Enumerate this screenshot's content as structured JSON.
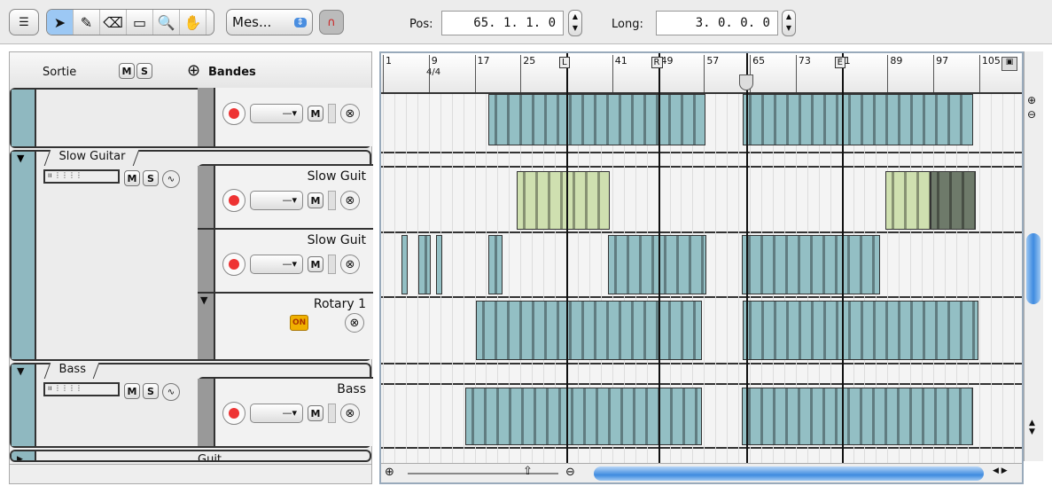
{
  "toolbar": {
    "mode_label": "Mes...",
    "pos_label": "Pos:",
    "pos_value": "65.  1.  1.   0",
    "long_label": "Long:",
    "long_value": "3.  0.  0.   0",
    "tools": [
      {
        "name": "pointer",
        "glyph": "➤"
      },
      {
        "name": "pencil",
        "glyph": "✎"
      },
      {
        "name": "eraser",
        "glyph": "⌫"
      },
      {
        "name": "marquee",
        "glyph": "▭"
      },
      {
        "name": "zoom",
        "glyph": "🔍"
      },
      {
        "name": "hand",
        "glyph": "✋"
      }
    ]
  },
  "left_header": {
    "sortie": "Sortie",
    "m": "M",
    "s": "S",
    "add_bands": "Bandes"
  },
  "groups": {
    "slow_guitar": "Slow Guitar",
    "bass": "Bass",
    "guitar": "Guit"
  },
  "lanes": {
    "slow1": "Slow Guit",
    "slow2": "Slow Guit",
    "rotary": "Rotary 1",
    "rotary_on": "ON",
    "bass": "Bass",
    "sel": "—▾",
    "m": "M",
    "s": "S",
    "x": "⊗"
  },
  "ruler": {
    "bars": [
      {
        "bar": 1,
        "label": "1"
      },
      {
        "bar": 9,
        "label": "9"
      },
      {
        "bar": 17,
        "label": "17"
      },
      {
        "bar": 25,
        "label": "25"
      },
      {
        "bar": 41,
        "label": "41"
      },
      {
        "bar": 49,
        "label": "49"
      },
      {
        "bar": 57,
        "label": "57"
      },
      {
        "bar": 65,
        "label": "65"
      },
      {
        "bar": 73,
        "label": "73"
      },
      {
        "bar": 81,
        "label": "1"
      },
      {
        "bar": 89,
        "label": "89"
      },
      {
        "bar": 97,
        "label": "97"
      },
      {
        "bar": 105,
        "label": "105"
      }
    ],
    "timesig": "4/4",
    "markers": [
      {
        "label": "L",
        "bar": 33
      },
      {
        "label": "R",
        "bar": 49
      },
      {
        "label": "E",
        "bar": 81
      }
    ],
    "playhead_bar": 65
  },
  "regions": [
    {
      "lane": 0,
      "start": 19.4,
      "end": 57.3,
      "color": "#93bfc4"
    },
    {
      "lane": 0,
      "start": 63.7,
      "end": 104,
      "color": "#93bfc4"
    },
    {
      "lane": 1,
      "start": 24.4,
      "end": 40.5,
      "color": "#cfe0b0"
    },
    {
      "lane": 1,
      "start": 88.6,
      "end": 96.5,
      "color": "#cfe0b0"
    },
    {
      "lane": 1,
      "start": 96.5,
      "end": 104.4,
      "color": "#6e7a6a"
    },
    {
      "lane": 2,
      "start": 4.2,
      "end": 5.3,
      "color": "#93bfc4"
    },
    {
      "lane": 2,
      "start": 7.2,
      "end": 9.4,
      "color": "#93bfc4"
    },
    {
      "lane": 2,
      "start": 10.3,
      "end": 11.4,
      "color": "#93bfc4"
    },
    {
      "lane": 2,
      "start": 19.4,
      "end": 21.9,
      "color": "#93bfc4"
    },
    {
      "lane": 2,
      "start": 40.3,
      "end": 57.4,
      "color": "#93bfc4"
    },
    {
      "lane": 2,
      "start": 63.6,
      "end": 87.7,
      "color": "#93bfc4"
    },
    {
      "lane": 3,
      "start": 17.2,
      "end": 56.7,
      "color": "#93bfc4"
    },
    {
      "lane": 3,
      "start": 63.7,
      "end": 104.9,
      "color": "#93bfc4"
    },
    {
      "lane": 4,
      "start": 15.4,
      "end": 56.7,
      "color": "#93bfc4"
    },
    {
      "lane": 4,
      "start": 63.6,
      "end": 104
    }
  ]
}
